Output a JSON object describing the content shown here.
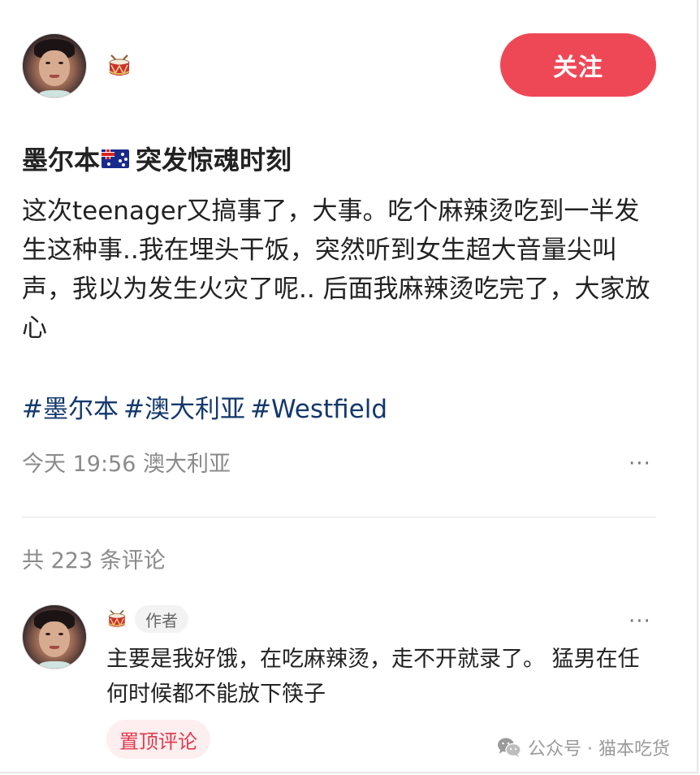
{
  "post": {
    "follow_label": "关注",
    "title_before_flag": "墨尔本",
    "title_after_flag": "突发惊魂时刻",
    "body": "这次teenager又搞事了，大事。吃个麻辣烫吃到一半发生这种事..我在埋头干饭，突然听到女生超大音量尖叫声，我以为发生火灾了呢.. 后面我麻辣烫吃完了，大家放心",
    "tags": [
      "#墨尔本",
      "#澳大利亚",
      "#Westfield"
    ],
    "timestamp": "今天 19:56",
    "location": "澳大利亚",
    "more_label": "···"
  },
  "comments": {
    "count_label": "共 223 条评论",
    "items": [
      {
        "author_badge": "作者",
        "text": "主要是我好饿，在吃麻辣烫，走不开就录了。 猛男在任何时候都不能放下筷子",
        "pinned_label": "置顶评论",
        "more_label": "···"
      }
    ]
  },
  "watermark": {
    "text": "公众号 · 猫本吃货"
  },
  "icons": {
    "user_badge": "drum-icon",
    "flag": "australia-flag-icon",
    "watermark_logo": "wechat-icon"
  },
  "colors": {
    "follow_button": "#ee4857",
    "tag_text": "#13386c",
    "pinned_text": "#e03b4f",
    "pinned_bg": "#fdeeef"
  }
}
